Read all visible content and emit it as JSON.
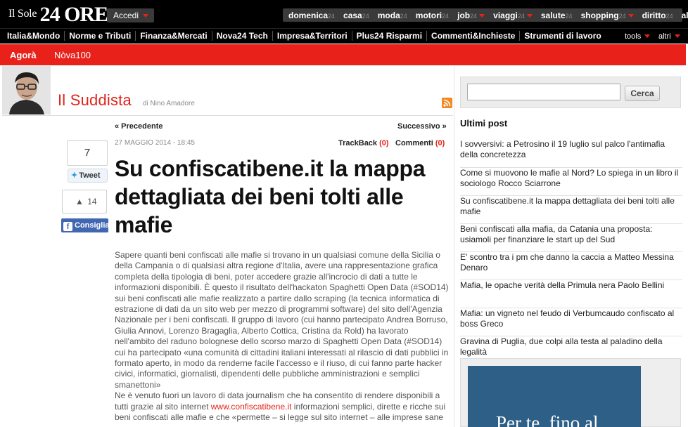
{
  "masthead": {
    "logo_small": "Il Sole",
    "logo_big": "24 ORE",
    "login_label": "Accedi",
    "channels": [
      {
        "label": "domenica",
        "num": "24",
        "dropdown": false
      },
      {
        "label": "casa",
        "num": "24",
        "dropdown": false
      },
      {
        "label": "moda",
        "num": "24",
        "dropdown": false
      },
      {
        "label": "motori",
        "num": "24",
        "dropdown": false
      },
      {
        "label": "job",
        "num": "24",
        "dropdown": true
      },
      {
        "label": "viaggi",
        "num": "24",
        "dropdown": true
      },
      {
        "label": "salute",
        "num": "24",
        "dropdown": false
      },
      {
        "label": "shopping",
        "num": "24",
        "dropdown": true
      },
      {
        "label": "diritto",
        "num": "24",
        "dropdown": false
      },
      {
        "label": "altri",
        "num": "",
        "dropdown": true
      }
    ]
  },
  "section_nav": {
    "items": [
      "Italia&Mondo",
      "Norme e Tributi",
      "Finanza&Mercati",
      "Nova24 Tech",
      "Impresa&Territori",
      "Plus24 Risparmi",
      "Commenti&Inchieste",
      "Strumenti di lavoro"
    ],
    "tools_label": "tools",
    "altri_label": "altri"
  },
  "subnav": {
    "agora": "Agorà",
    "nova": "Nòva100"
  },
  "blog": {
    "title": "Il Suddista",
    "byline": "di Nino Amadore"
  },
  "article": {
    "prev_label": "« Precedente",
    "next_label": "Successivo »",
    "date": "27 MAGGIO 2014 - 18:45",
    "trackback_label": "TrackBack",
    "trackback_count": "(0)",
    "comments_label": "Commenti",
    "comments_count": "(0)",
    "title": "Su confiscatibene.it la mappa dettagliata dei beni tolti alle mafie",
    "para1": "Sapere quanti beni confiscati alle mafie si trovano in un qualsiasi comune della Sicilia o della Campania o di qualsiasi altra regione d'Italia, avere una rappresentazione grafica completa della tipologia di beni, poter accedere grazie all'incrocio di dati a tutte le informazioni disponibili. È questo il risultato dell'hackaton Spaghetti Open Data (#SOD14)  sui beni confiscati alle mafie realizzato a partire dallo scraping (la tecnica informatica di estrazione di dati da un sito web per mezzo di programmi software) del sito dell'Agenzia Nazionale per i beni confiscati. Il gruppo di lavoro (cui hanno partecipato Andrea Borruso, Giulia Annovi, Lorenzo Bragaglia, Alberto Cottica, Cristina da Rold) ha lavorato  nell'ambito del raduno bolognese dello scorso marzo di Spaghetti Open Data (#SOD14) cui ha partecipato «una comunità di cittadini italiani interessati al rilascio di dati pubblici in formato aperto, in modo da renderne facile l'accesso e il riuso, di cui fanno parte hacker civici, informatici, giornalisti, dipendenti delle pubbliche amministrazioni e semplici smanettoni»",
    "para2_before": "Ne è venuto fuori un lavoro di data journalism che ha consentito di rendere disponibili a tutti grazie al sito internet ",
    "para2_link": "www.confiscatibene.it",
    "para2_after": " informazioni semplici, dirette e ricche sui beni confiscati alle mafie e che «permette – si legge sul sito internet – alle imprese sane"
  },
  "social": {
    "tweet_count": "7",
    "tweet_label": "Tweet",
    "like_count": "14",
    "fb_label": "Consiglia"
  },
  "sidebar": {
    "search_button": "Cerca",
    "search_value": "",
    "recent_title": "Ultimi post",
    "posts": [
      "I sovversivi: a Petrosino il 19 luglio sul palco l'antimafia della concretezza",
      "Come si muovono le mafie al Nord? Lo spiega in un libro il sociologo Rocco Sciarrone",
      "Su confiscatibene.it la mappa dettagliata dei beni tolti alle mafie",
      "Beni confiscati alla mafia, da Catania una proposta: usiamoli per finanziare le start up del Sud",
      "E' scontro tra i pm che danno la caccia a Matteo Messina Denaro",
      "Mafia, le opache verità della Primula nera Paolo Bellini",
      "Mafia: un vigneto nel feudo di Verbumcaudo confiscato al boss Greco",
      "Gravina di Puglia, due colpi alla testa al paladino della legalità"
    ],
    "ad_text": "Per te, fino al"
  },
  "colors": {
    "brand_red": "#e8221b",
    "link_red": "#e0241b",
    "facebook_blue": "#4267b2",
    "ad_blue": "#2e5f86"
  }
}
